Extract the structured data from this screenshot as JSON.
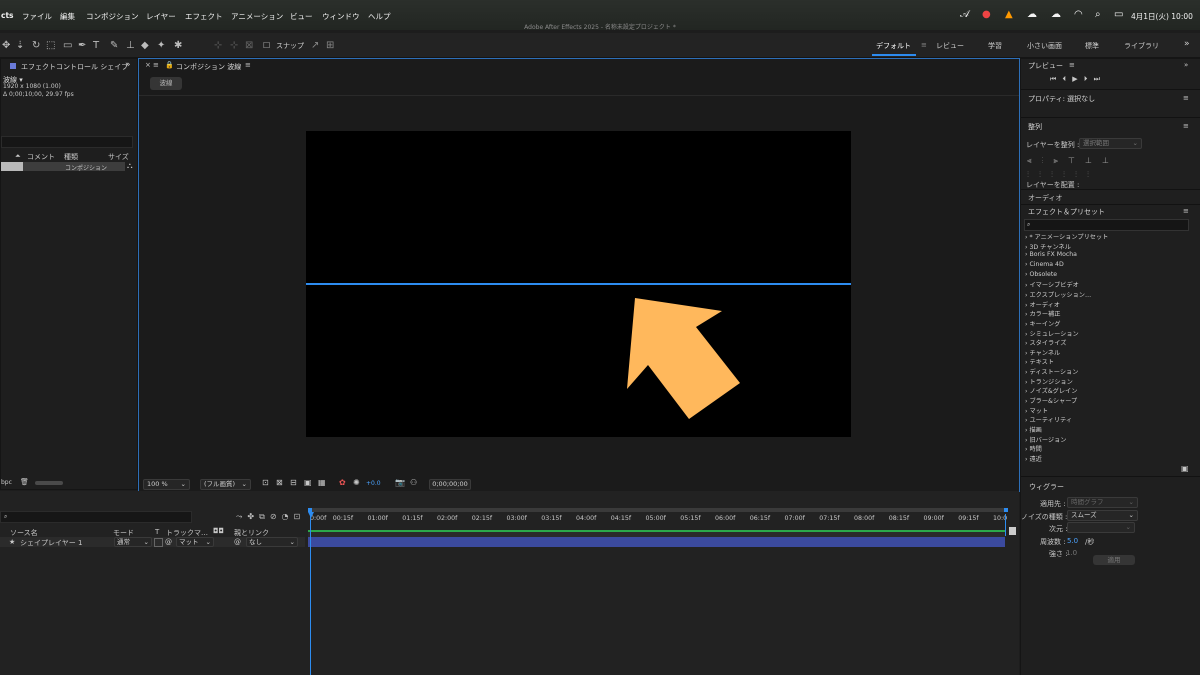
{
  "menubar": {
    "app": "cts",
    "items": [
      "ファイル",
      "編集",
      "コンポジション",
      "レイヤー",
      "エフェクト",
      "アニメーション",
      "ビュー",
      "ウィンドウ",
      "ヘルプ"
    ],
    "clock": "4月1日(火)  10:00",
    "status_icons": [
      "creative-cloud-icon",
      "record-icon",
      "vlc-icon",
      "cloud-icon",
      "cloud-icon",
      "wifi-icon",
      "search-icon",
      "control-center-icon",
      "siri-icon"
    ]
  },
  "window_title": "Adobe After Effects 2025 - 名称未設定プロジェクト *",
  "toolbar": {
    "snap_label": "スナップ",
    "workspaces": [
      "デフォルト",
      "レビュー",
      "学習",
      "小さい画面",
      "標準",
      "ライブラリ"
    ],
    "active_workspace": "デフォルト"
  },
  "project_panel": {
    "title": "エフェクトコントロール シェイプ",
    "comp_name": "波線 ▾",
    "comp_size": "1920 x 1080 (1.00)",
    "comp_duration": "Δ 0;00;10;00, 29.97 fps",
    "columns": [
      "コメント",
      "種類",
      "サイズ"
    ],
    "row_type": "コンポジション",
    "bpc": "bpc"
  },
  "composition": {
    "panel_title": "コンポジション 波線",
    "tab_label": "波線",
    "zoom": "100 %",
    "resolution": "(フル画質)",
    "exposure": "+0.0",
    "timecode": "0;00;00;00"
  },
  "timeline": {
    "columns": {
      "source": "ソース名",
      "mode": "モード",
      "t": "T",
      "track": "トラックマ…",
      "parent": "親とリンク"
    },
    "layer": {
      "name": "シェイプレイヤー 1",
      "mode": "通常",
      "track": "マット",
      "parent": "なし"
    },
    "ruler": [
      "0:00f",
      "00:15f",
      "01:00f",
      "01:15f",
      "02:00f",
      "02:15f",
      "03:00f",
      "03:15f",
      "04:00f",
      "04:15f",
      "05:00f",
      "05:15f",
      "06:00f",
      "06:15f",
      "07:00f",
      "07:15f",
      "08:00f",
      "08:15f",
      "09:00f",
      "09:15f",
      "10:0"
    ]
  },
  "right_panel": {
    "preview_title": "プレビュー",
    "properties_title": "プロパティ: 選択なし",
    "align_title": "整列",
    "align_layers_label": "レイヤーを整列 :",
    "align_target": "選択範囲",
    "distribute_label": "レイヤーを配置 :",
    "audio_label": "オーディオ",
    "effects_title": "エフェクト＆プリセット",
    "effects_items": [
      "* アニメーションプリセット",
      "3D チャンネル",
      "Boris FX Mocha",
      "Cinema 4D",
      "Obsolete",
      "イマーシブビデオ",
      "エクスプレッション…",
      "オーディオ",
      "カラー補正",
      "キーイング",
      "シミュレーション",
      "スタイライズ",
      "チャンネル",
      "テキスト",
      "ディストーション",
      "トランジション",
      "ノイズ&グレイン",
      "ブラー&シャープ",
      "マット",
      "ユーティリティ",
      "描画",
      "旧バージョン",
      "時間",
      "遠近"
    ],
    "wiggler_title": "ウィグラー",
    "wiggler": {
      "apply_to_label": "適用先 :",
      "apply_to_value": "時間グラフ",
      "noise_label": "ノイズの種類 :",
      "noise_value": "スムーズ",
      "dimension_label": "次元 :",
      "frequency_label": "周波数 :",
      "frequency_value": "5.0",
      "frequency_unit": "/秒",
      "magnitude_label": "強さ :",
      "magnitude_value": "1.0",
      "apply_button": "適用"
    }
  },
  "colors": {
    "accent": "#2d8cf0",
    "arrow": "#ffb85c",
    "layer_bar": "#3b4a9e",
    "track_green": "#2ba84a"
  }
}
